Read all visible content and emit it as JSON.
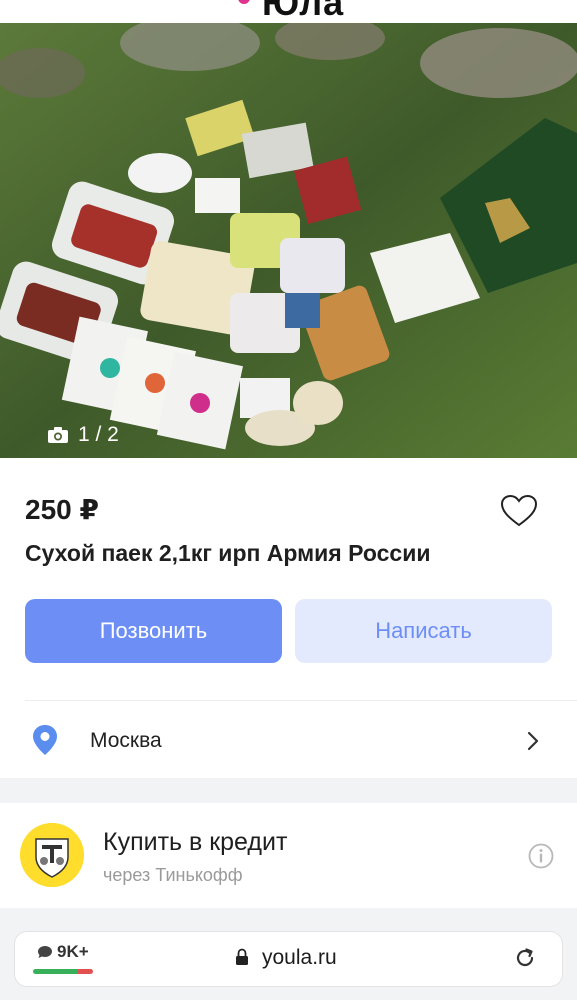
{
  "header": {
    "logo_text": "Юла"
  },
  "gallery": {
    "counter": "1 / 2"
  },
  "listing": {
    "price": "250 ₽",
    "title": "Сухой паек 2,1кг ирп Армия России",
    "call_label": "Позвонить",
    "write_label": "Написать",
    "location": "Москва"
  },
  "credit": {
    "title": "Купить в кредит",
    "subtitle": "через Тинькофф"
  },
  "browser": {
    "tabs_count": "9K+",
    "url": "youla.ru"
  },
  "colors": {
    "accent": "#6d8ff5",
    "accent_light": "#e3eafd",
    "tinkoff_yellow": "#ffdd2d",
    "location_pin": "#5b8def"
  },
  "icons": [
    "heart-icon",
    "camera-icon",
    "location-pin-icon",
    "chevron-right-icon",
    "tinkoff-logo",
    "info-icon",
    "chat-bubble-icon",
    "lock-icon",
    "reload-icon"
  ]
}
